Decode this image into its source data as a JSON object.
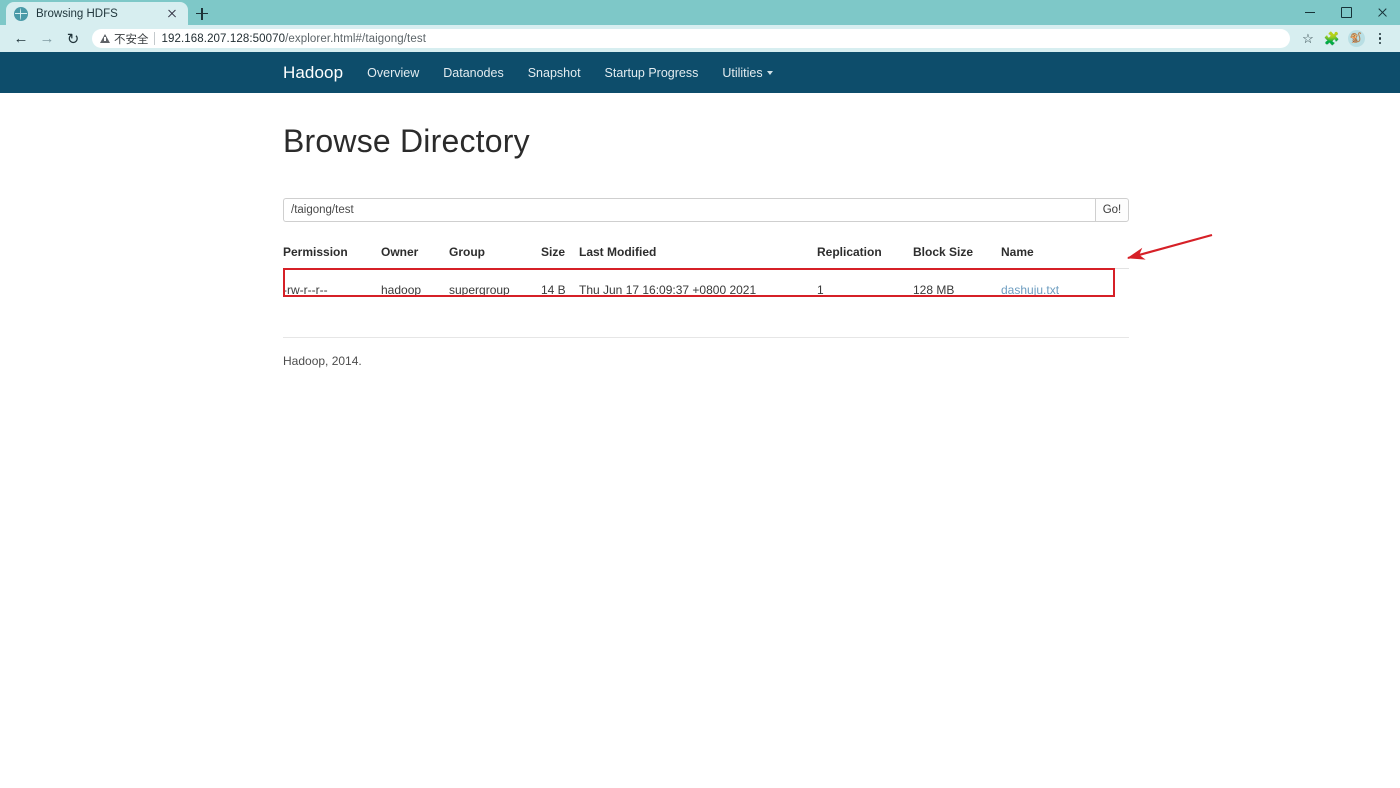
{
  "browser": {
    "tab": {
      "title": "Browsing HDFS",
      "favicon": "globe-icon",
      "close_label": "×"
    },
    "new_tab_label": "+",
    "window_controls": {
      "minimize": "–",
      "maximize": "□",
      "close": "×"
    },
    "toolbar": {
      "back": "←",
      "forward": "→",
      "reload": "↻",
      "security_label": "不安全",
      "url_host": "192.168.207.128:50070",
      "url_path": "/explorer.html#/taigong/test",
      "bookmark_icon": "☆",
      "extensions_icon": "puzzle-piece",
      "profile_icon": "avatar",
      "menu_icon": "kebab"
    }
  },
  "nav": {
    "brand": "Hadoop",
    "links": [
      {
        "label": "Overview",
        "dropdown": false
      },
      {
        "label": "Datanodes",
        "dropdown": false
      },
      {
        "label": "Snapshot",
        "dropdown": false
      },
      {
        "label": "Startup Progress",
        "dropdown": false
      },
      {
        "label": "Utilities",
        "dropdown": true
      }
    ]
  },
  "page": {
    "title": "Browse Directory",
    "path_value": "/taigong/test",
    "path_placeholder": "/taigong/test",
    "go_label": "Go!",
    "footer": "Hadoop, 2014."
  },
  "table": {
    "headers": [
      "Permission",
      "Owner",
      "Group",
      "Size",
      "Last Modified",
      "Replication",
      "Block Size",
      "Name"
    ],
    "rows": [
      {
        "permission": "-rw-r--r--",
        "owner": "hadoop",
        "group": "supergroup",
        "size": "14 B",
        "last_modified": "Thu Jun 17 16:09:37 +0800 2021",
        "replication": "1",
        "block_size": "128 MB",
        "name": "dashuju.txt"
      }
    ]
  },
  "annotation": {
    "highlight_color": "#d62027",
    "arrow_color": "#d62027",
    "arrow_direction": "left"
  },
  "colors": {
    "nav_background": "#0d4d6b",
    "chrome_background": "#7ec8c8",
    "tab_background": "#d7eef0",
    "link": "#6d9dc0",
    "accent_red": "#d62027"
  }
}
